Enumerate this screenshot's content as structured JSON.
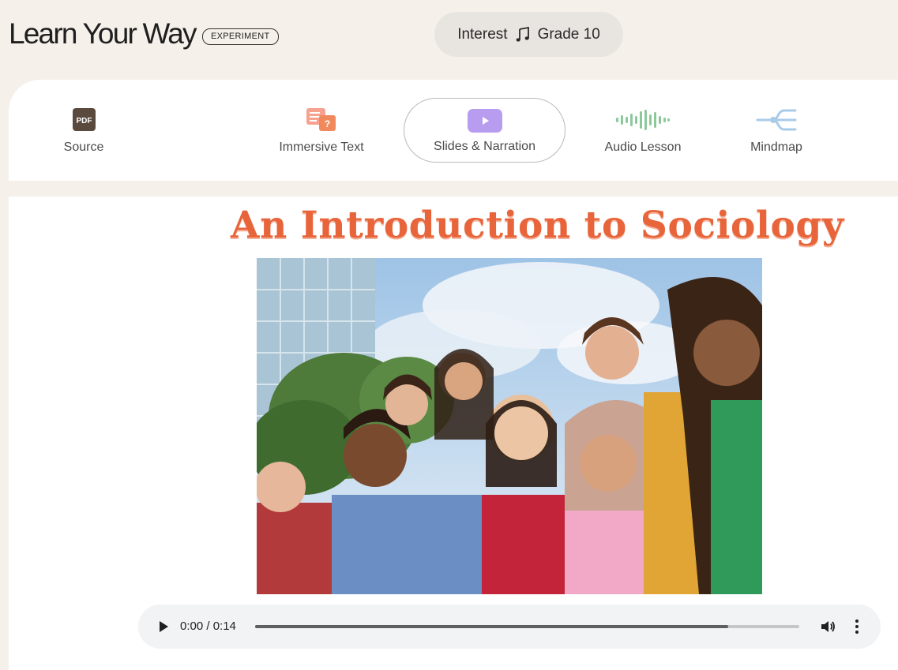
{
  "header": {
    "app_title": "Learn Your Way",
    "badge": "EXPERIMENT",
    "interest_label": "Interest",
    "interest_icon": "music-note-icon",
    "grade_label": "Grade 10"
  },
  "tabs": [
    {
      "label": "Source",
      "icon": "pdf-icon"
    },
    {
      "label": "Immersive Text",
      "icon": "immersive-text-icon"
    },
    {
      "label": "Slides & Narration",
      "icon": "play-video-icon",
      "selected": true
    },
    {
      "label": "Audio Lesson",
      "icon": "audio-waveform-icon"
    },
    {
      "label": "Mindmap",
      "icon": "mindmap-icon"
    }
  ],
  "slide": {
    "title": "An Introduction to Sociology",
    "image": "group-of-diverse-smiling-students-photo"
  },
  "audio_player": {
    "time": "0:00 / 0:14",
    "progress": 0.87
  },
  "colors": {
    "page_bg": "#f5f0ea",
    "title_orange": "#e8643a",
    "pdf_icon_brown": "#5a4a3e",
    "immersive_orange": "#f4836b",
    "slides_purple": "#b79cf0",
    "audio_green": "#8cc99a",
    "mindmap_blue": "#a9cbe8"
  }
}
